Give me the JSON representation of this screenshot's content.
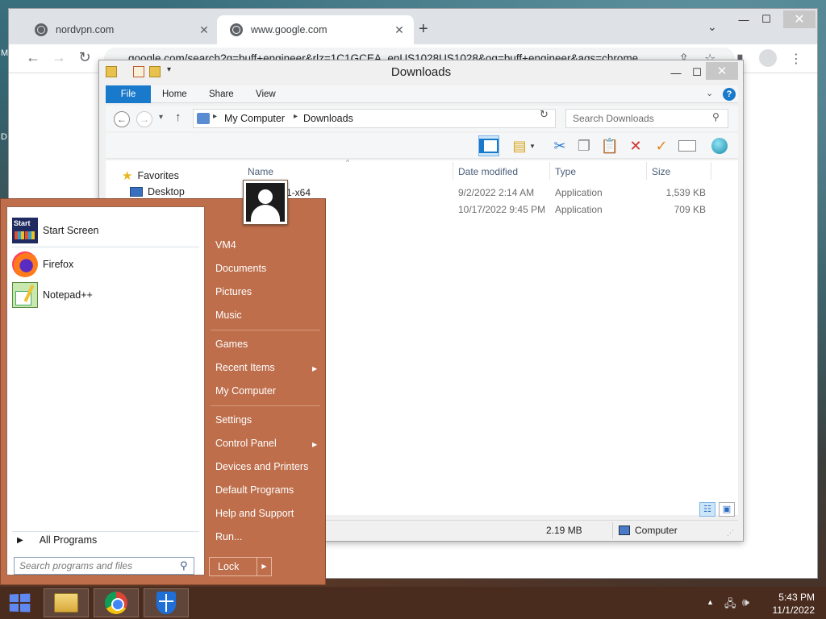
{
  "desktop": {
    "edge_label_1": "M",
    "edge_label_2": "D"
  },
  "chrome": {
    "tabs": [
      {
        "title": "nordvpn.com",
        "close": "✕"
      },
      {
        "title": "www.google.com",
        "close": "✕"
      }
    ],
    "new_tab": "+",
    "tab_search": "⌄",
    "window_controls": {
      "minimize": "—",
      "maximize": "☐",
      "close": "✕"
    },
    "nav": {
      "back": "←",
      "forward": "→",
      "reload": "↻"
    },
    "omnibox_url": "google.com/search?q=buff+engineer&rlz=1C1GCEA_enUS1028US1028&oq=buff+engineer&aqs=chrome",
    "toolbar_icons": {
      "share": "⇪",
      "star": "☆",
      "sidebar": "▮",
      "menu": "⋮"
    }
  },
  "explorer": {
    "title": "Downloads",
    "window_controls": {
      "minimize": "—",
      "maximize": "☐",
      "close": "✕"
    },
    "ribbon_tabs": [
      "File",
      "Home",
      "Share",
      "View"
    ],
    "ribbon_collapse": "⌄",
    "help": "?",
    "address": {
      "breadcrumbs": [
        "My Computer",
        "Downloads"
      ],
      "back": "←",
      "forward": "→",
      "recent": "▾",
      "up": "↑",
      "separator": "▸",
      "dropdown": "⌄",
      "refresh": "↻"
    },
    "search_placeholder": "Search Downloads",
    "search_icon": "⚲",
    "command_icons": {
      "cut": "✂",
      "copy": "❐",
      "paste": "📋",
      "delete": "✕",
      "rename": "✓",
      "props_dropdown": "▾"
    },
    "navigation": {
      "favorites": "Favorites",
      "desktop": "Desktop"
    },
    "columns": [
      "Name",
      "Date modified",
      "Type",
      "Size"
    ],
    "sort_indicator": "^",
    "files": [
      {
        "name": "1-x64",
        "date": "9/2/2022 2:14 AM",
        "type": "Application",
        "size": "1,539 KB"
      },
      {
        "name": "",
        "date": "10/17/2022 9:45 PM",
        "type": "Application",
        "size": "709 KB"
      }
    ],
    "status": {
      "size": "2.19 MB",
      "location": "Computer",
      "grip": "⋰"
    },
    "view_buttons": {
      "details": "☷",
      "large": "▣"
    }
  },
  "start_menu": {
    "pinned": [
      {
        "label": "Start Screen",
        "icon": "start-screen-icon",
        "icon_text": "Start"
      },
      {
        "label": "Firefox",
        "icon": "firefox-icon"
      },
      {
        "label": "Notepad++",
        "icon": "notepad-plus-plus-icon"
      }
    ],
    "all_programs": "All Programs",
    "all_programs_arrow": "▶",
    "search_placeholder": "Search programs and files",
    "search_icon": "⚲",
    "links": [
      {
        "label": "VM4",
        "submenu": false
      },
      {
        "label": "Documents",
        "submenu": false
      },
      {
        "label": "Pictures",
        "submenu": false
      },
      {
        "label": "Music",
        "submenu": false
      },
      {
        "label": "Games",
        "submenu": false
      },
      {
        "label": "Recent Items",
        "submenu": true
      },
      {
        "label": "My Computer",
        "submenu": false
      },
      {
        "label": "Settings",
        "submenu": false
      },
      {
        "label": "Control Panel",
        "submenu": true
      },
      {
        "label": "Devices and Printers",
        "submenu": false
      },
      {
        "label": "Default Programs",
        "submenu": false
      },
      {
        "label": "Help and Support",
        "submenu": false
      },
      {
        "label": "Run...",
        "submenu": false
      }
    ],
    "submenu_arrow": "▶",
    "lock": "Lock",
    "lock_arrow": "▶"
  },
  "taskbar": {
    "apps": [
      "file-explorer",
      "chrome",
      "windows-defender"
    ],
    "tray": {
      "arrow": "▲",
      "network": "🖧",
      "volume": "🕪"
    },
    "time": "5:43 PM",
    "date": "11/1/2022"
  },
  "colors": {
    "start_menu_bg": "#be6e4b",
    "taskbar_bg": "#4a2c1f",
    "ribbon_file_tab": "#1979ca",
    "chrome_titlebar": "#dee1e6"
  }
}
